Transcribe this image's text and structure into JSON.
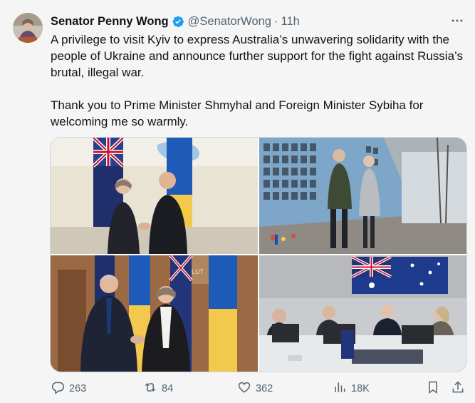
{
  "author": {
    "name": "Senator Penny Wong",
    "handle": "@SenatorWong",
    "separator": "·",
    "time": "11h"
  },
  "tweet": {
    "paragraph1": "A privilege to visit Kyiv to express Australia’s unwavering solidarity with the people of Ukraine and announce further support for the fight against Russia’s brutal, illegal war.",
    "paragraph2": "Thank you to Prime Minister Shmyhal and Foreign Minister Sybiha for welcoming me so warmly."
  },
  "media": {
    "sign_text": "SALUT"
  },
  "actions": {
    "replies": "263",
    "reposts": "84",
    "likes": "362",
    "views": "18K"
  },
  "colors": {
    "text": "#0f1419",
    "muted": "#536471",
    "verified": "#1d9bf0",
    "ukraine_blue": "#0057b7",
    "ukraine_yellow": "#ffd700",
    "australia_blue": "#012169"
  },
  "icons": [
    "verified-badge-icon",
    "more-icon",
    "reply-icon",
    "retweet-icon",
    "like-icon",
    "views-icon",
    "bookmark-icon",
    "share-icon"
  ]
}
